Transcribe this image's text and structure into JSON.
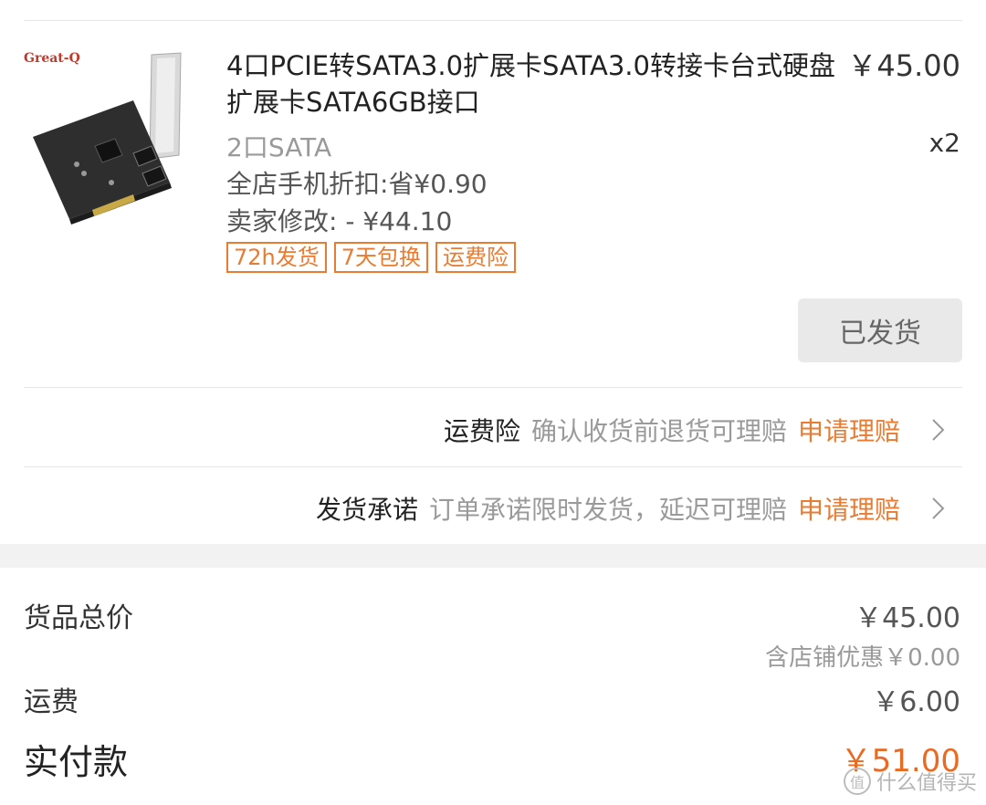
{
  "product": {
    "brand": "Great-Q",
    "title": "4口PCIE转SATA3.0扩展卡SATA3.0转接卡台式硬盘扩展卡SATA6GB接口",
    "price": "￥45.00",
    "quantity": "x2",
    "sku": "2口SATA",
    "discount": "全店手机折扣:省¥0.90",
    "seller_change": "卖家修改: - ¥44.10",
    "tags": [
      "72h发货",
      "7天包换",
      "运费险"
    ],
    "status_button": "已发货"
  },
  "services": [
    {
      "key": "运费险",
      "desc": "确认收货前退货可理赔",
      "action": "申请理赔"
    },
    {
      "key": "发货承诺",
      "desc": "订单承诺限时发货，延迟可理赔",
      "action": "申请理赔"
    }
  ],
  "summary": {
    "goods_label": "货品总价",
    "goods_value": "￥45.00",
    "store_discount": "含店铺优惠￥0.00",
    "shipping_label": "运费",
    "shipping_value": "￥6.00",
    "paid_label": "实付款",
    "paid_value": "￥51.00"
  },
  "watermark": "什么值得买",
  "colors": {
    "accent": "#ea7b32",
    "paid": "#ea6a22"
  }
}
